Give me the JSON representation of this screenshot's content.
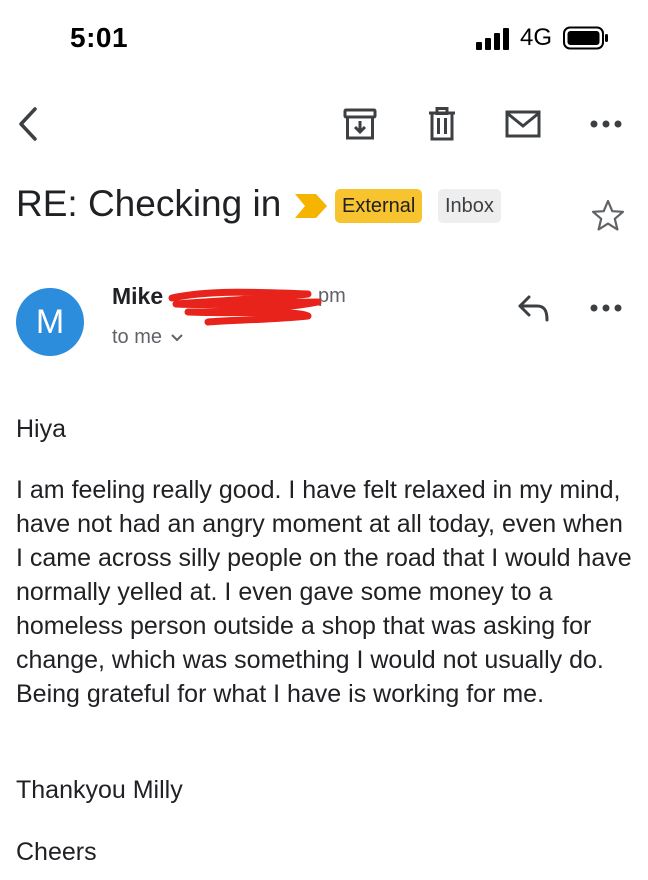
{
  "status_bar": {
    "time": "5:01",
    "network": "4G"
  },
  "toolbar": {
    "icons": [
      "back-arrow-icon",
      "archive-icon",
      "trash-icon",
      "mail-icon",
      "more-horizontal-icon"
    ]
  },
  "email": {
    "subject": "RE: Checking in",
    "labels": [
      "External",
      "Inbox"
    ],
    "sender_name": "Mike",
    "send_time": "pm",
    "recipient": "to me",
    "avatar_letter": "M",
    "greeting": "Hiya",
    "paragraph": "I am feeling really good. I have felt relaxed in my mind, have not had an angry moment at all today, even when I came across silly people on the road that I would have normally yelled at. I even gave some money to a homeless person outside a shop that was asking for change, which was something I would not usually do. Being grateful for what I have is working for me.",
    "thanks": "Thankyou Milly",
    "signoff": "Cheers"
  },
  "colors": {
    "avatar": "#2c8ddc",
    "external_label": "#f7c32e",
    "importance_marker": "#f5b400",
    "redaction": "#e8231c"
  }
}
